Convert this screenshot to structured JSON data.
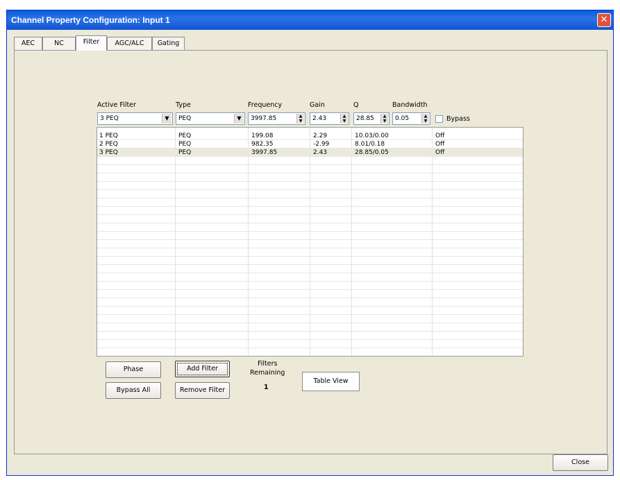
{
  "window": {
    "title": "Channel Property Configuration: Input 1"
  },
  "tabs": [
    {
      "label": "AEC"
    },
    {
      "label": "NC"
    },
    {
      "label": "Filter"
    },
    {
      "label": "AGC/ALC"
    },
    {
      "label": "Gating"
    }
  ],
  "active_tab": "Filter",
  "controls": {
    "active_filter": {
      "label": "Active Filter",
      "value": "3 PEQ"
    },
    "type": {
      "label": "Type",
      "value": "PEQ"
    },
    "frequency": {
      "label": "Frequency",
      "value": "3997.85"
    },
    "gain": {
      "label": "Gain",
      "value": "2.43"
    },
    "q": {
      "label": "Q",
      "value": "28.85"
    },
    "bandwidth": {
      "label": "Bandwidth",
      "value": "0.05"
    },
    "bypass": {
      "label": "Bypass",
      "checked": false
    }
  },
  "table": {
    "rows": [
      {
        "filter": "1 PEQ",
        "type": "PEQ",
        "frequency": "199.08",
        "gain": "2.29",
        "q_bw": "10.03/0.00",
        "bypass": "Off"
      },
      {
        "filter": "2 PEQ",
        "type": "PEQ",
        "frequency": "982.35",
        "gain": "-2.99",
        "q_bw": "8.01/0.18",
        "bypass": "Off"
      },
      {
        "filter": "3 PEQ",
        "type": "PEQ",
        "frequency": "3997.85",
        "gain": "2.43",
        "q_bw": "28.85/0.05",
        "bypass": "Off"
      }
    ],
    "selected_row": 2
  },
  "buttons": {
    "phase": "Phase",
    "bypass_all": "Bypass All",
    "add_filter": "Add Filter",
    "remove_filter": "Remove Filter",
    "table_view": "Table View",
    "close": "Close"
  },
  "filters_remaining": {
    "label_line1": "Filters",
    "label_line2": "Remaining",
    "value": "1"
  },
  "colors": {
    "titlebar": "#0a5bd6",
    "selected_row": "#ebe9dc",
    "close_icon": "#e0543c"
  },
  "icons": {
    "close": "close-icon",
    "dropdown": "chevron-down-icon",
    "spinner": "spinner-updown-icon"
  }
}
